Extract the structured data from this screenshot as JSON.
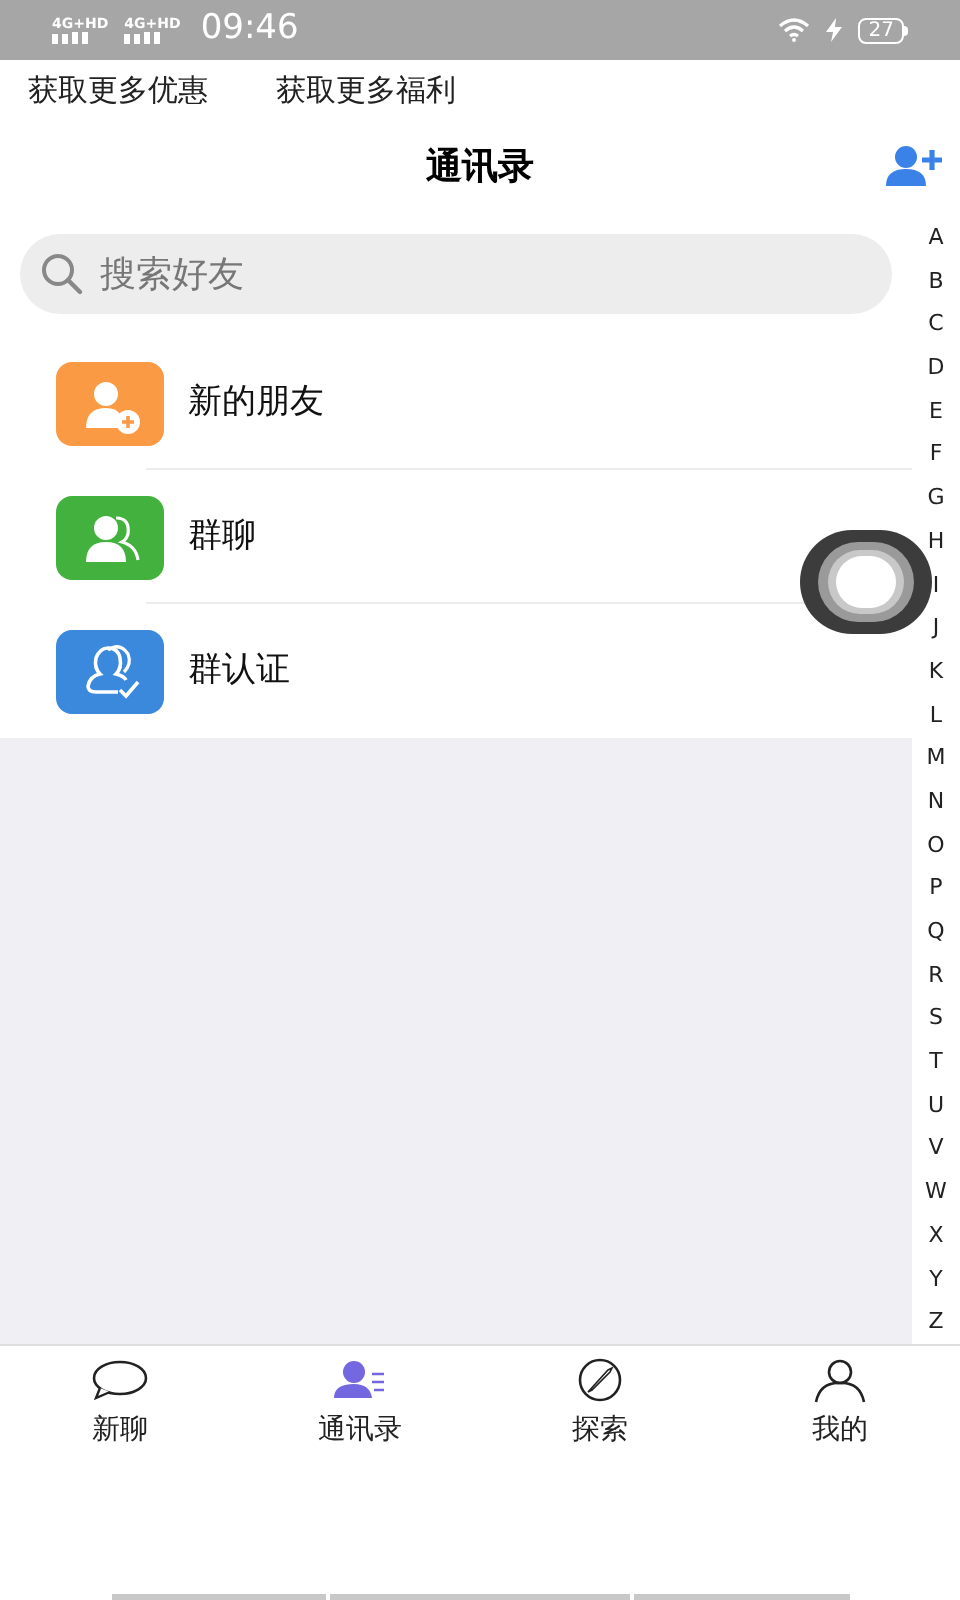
{
  "status_bar": {
    "signals": [
      "4G+HD",
      "4G+HD"
    ],
    "time": "09:46",
    "battery": "27"
  },
  "promo_links": [
    "获取更多优惠",
    "获取更多福利"
  ],
  "header": {
    "title": "通讯录"
  },
  "search": {
    "placeholder": "搜索好友"
  },
  "entries": [
    {
      "kind": "new-friend",
      "label": "新的朋友",
      "color": "#fb9a45"
    },
    {
      "kind": "group-chat",
      "label": "群聊",
      "color": "#43b13e"
    },
    {
      "kind": "group-verify",
      "label": "群认证",
      "color": "#3a89dc"
    }
  ],
  "index_letters": [
    "A",
    "B",
    "C",
    "D",
    "E",
    "F",
    "G",
    "H",
    "I",
    "J",
    "K",
    "L",
    "M",
    "N",
    "O",
    "P",
    "Q",
    "R",
    "S",
    "T",
    "U",
    "V",
    "W",
    "X",
    "Y",
    "Z"
  ],
  "tabs": [
    {
      "kind": "chat",
      "label": "新聊",
      "selected": false
    },
    {
      "kind": "contacts",
      "label": "通讯录",
      "selected": true
    },
    {
      "kind": "explore",
      "label": "探索",
      "selected": false
    },
    {
      "kind": "me",
      "label": "我的",
      "selected": false
    }
  ]
}
